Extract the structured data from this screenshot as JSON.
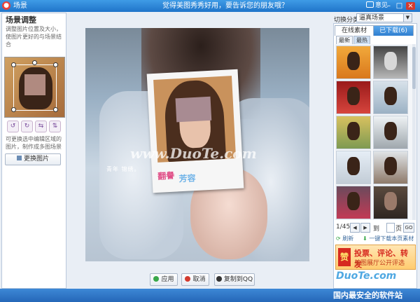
{
  "window": {
    "title": "场景",
    "promo": "觉得美图秀秀好用，要告诉您的朋友哦？",
    "feedback": "意见",
    "controls": [
      "–",
      "□",
      "×"
    ]
  },
  "left_panel": {
    "title": "场景调整",
    "description": "调整图片位置及大小，使图片更好的与场景结合",
    "tool_icons": [
      "rotate-left-icon",
      "rotate-right-icon",
      "flip-horizontal-icon",
      "flip-vertical-icon"
    ],
    "note": "可更换选中编辑区域的图片，制作成多图场景",
    "change_button": "更换图片"
  },
  "canvas": {
    "caption": "青年  锦绣。",
    "polaroid_caption_1": "翻譽",
    "polaroid_caption_2": "芳容",
    "watermark": "www.DuoTe.com"
  },
  "bottom_buttons": {
    "apply": "应用",
    "cancel": "取消",
    "copy_to_qq": "复制到QQ"
  },
  "right_panel": {
    "category_label": "切换分类",
    "category_value": "逼真场景",
    "tabs": [
      "在线素材",
      "已下载(6)"
    ],
    "subtabs": [
      "最新",
      "最热"
    ],
    "page_current": "1/45",
    "goto_label": "到",
    "page_unit": "页",
    "go_label": "GO",
    "refresh_label": "刷新",
    "download_page_label": "一键下载本页素材",
    "promo": {
      "badge": "赞",
      "line1": "投票、评论、转发",
      "line2": "美图展厅公开评选"
    },
    "watermark": "DuoTe.com"
  },
  "status_bar": {
    "watermark": "国内最安全的软件站"
  },
  "colors": {
    "titlebar": "#2a7fd4",
    "accent_pink": "#e04f87",
    "accent_blue": "#6fb3e8",
    "promo_red": "#d62a1f"
  }
}
